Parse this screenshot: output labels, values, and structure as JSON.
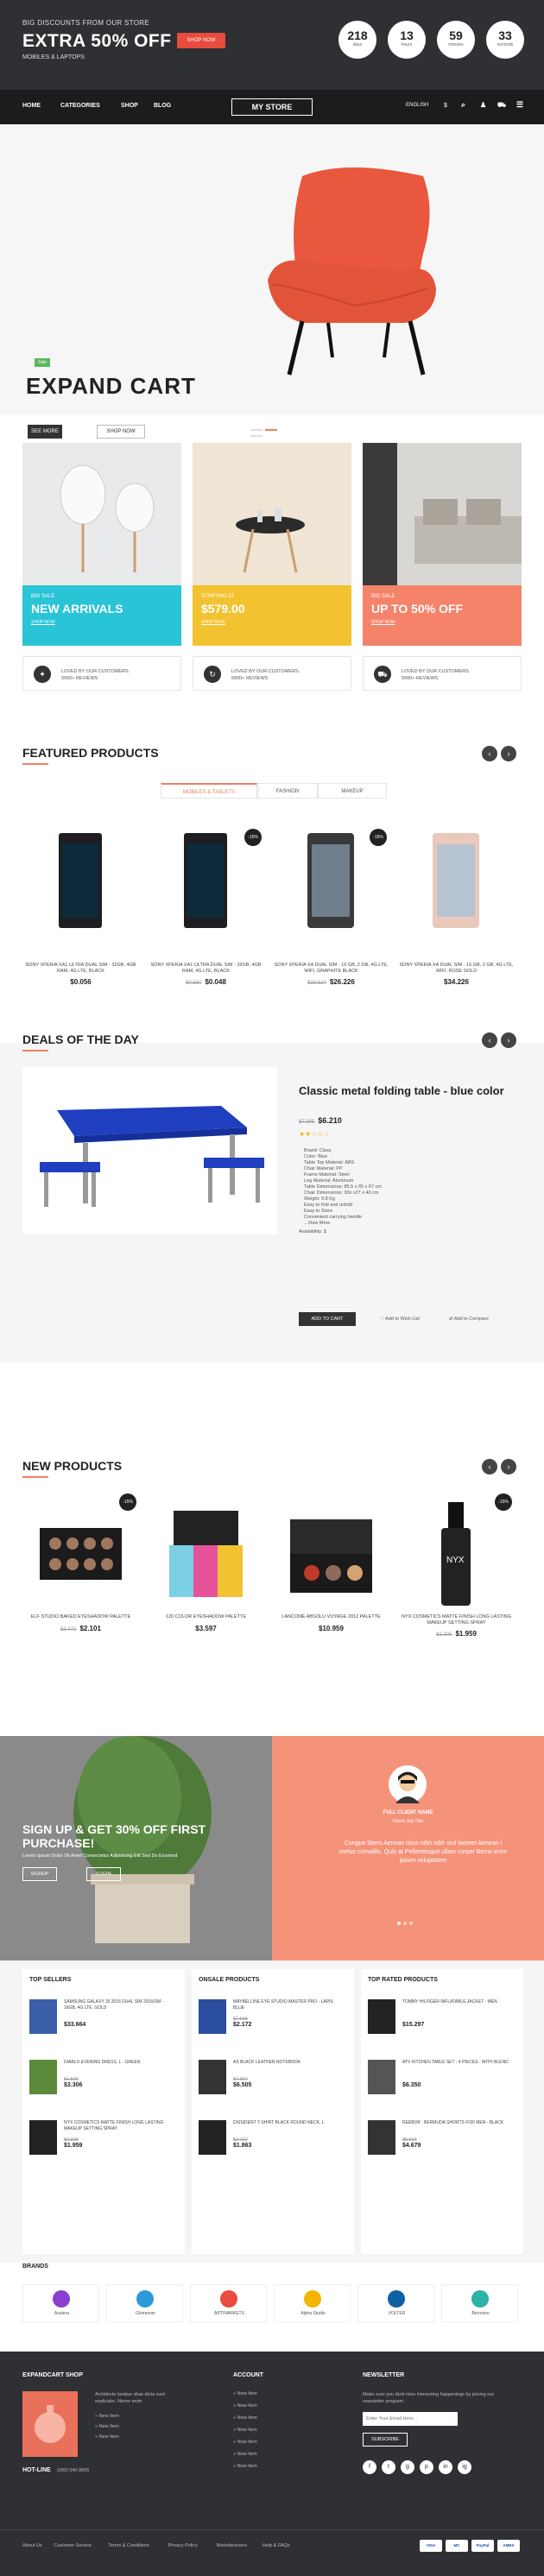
{
  "topbar": {
    "line1": "BIG DISCOUNTS FROM OUR STORE",
    "line2": "EXTRA 50% OFF",
    "line3": "MOBILES & LAPTOPS",
    "shop_btn": "SHOP NOW",
    "countdown": [
      {
        "value": "218",
        "label": "days"
      },
      {
        "value": "13",
        "label": "hours"
      },
      {
        "value": "59",
        "label": "minutes"
      },
      {
        "value": "33",
        "label": "seconds"
      }
    ]
  },
  "nav": {
    "items": [
      "HOME",
      "CATEGORIES",
      "SHOP",
      "BLOG"
    ],
    "logo": "MY STORE",
    "language": "ENGLISH",
    "currency": "$"
  },
  "hero": {
    "badge": "Sale",
    "title": "EXPAND CART",
    "see_more": "SEE MORE",
    "shop_now": "SHOP NOW"
  },
  "banners": [
    {
      "small": "BIG SALE",
      "big": "NEW ARRIVALS",
      "link": "SHOP NOW",
      "color": "#29c4d6"
    },
    {
      "small": "STARTING AT",
      "big": "$579.00",
      "link": "SHOP NOW",
      "color": "#f2c230"
    },
    {
      "small": "BIG SALE",
      "big": "UP TO 50% OFF",
      "link": "SHOP NOW",
      "color": "#f5836a"
    }
  ],
  "features": [
    {
      "icon": "tag-icon",
      "text1": "LOVED BY OUR CUSTOMERS.",
      "text2": "5000+ REVIEWS"
    },
    {
      "icon": "refresh-icon",
      "text1": "LOVED BY OUR CUSTOMERS.",
      "text2": "5000+ REVIEWS"
    },
    {
      "icon": "truck-icon",
      "text1": "LOVED BY OUR CUSTOMERS.",
      "text2": "5000+ REVIEWS"
    }
  ],
  "featured": {
    "title": "FEATURED PRODUCTS",
    "tabs": [
      "MOBILES & TABLETS",
      "FASHION",
      "MAKEUP"
    ],
    "products": [
      {
        "name": "SONY XPERIA XA1 ULTRA DUAL SIM - 32GB, 4GB RAM, 4G LTE, BLACK",
        "old": "",
        "price": "$0.056",
        "discount": ""
      },
      {
        "name": "SONY XPERIA XA1 ULTRA DUAL SIM - 32GB, 4GB RAM, 4G LTE, BLACK",
        "old": "$0.560",
        "price": "$0.048",
        "discount": "-15%"
      },
      {
        "name": "SONY XPERIA XA DUAL SIM - 16 GB, 2 GB, 4G LTE, WIFI, GRAPHITE BLACK",
        "old": "$30.824",
        "price": "$26.226",
        "discount": "-15%"
      },
      {
        "name": "SONY XPERIA XA DUAL SIM - 16 GB, 2 GB, 4G LTE, WIFI, ROSE GOLD",
        "old": "",
        "price": "$34.226",
        "discount": ""
      }
    ]
  },
  "deals": {
    "title": "DEALS OF THE DAY",
    "product_title": "Classic metal folding table - blue color",
    "old": "$7.305",
    "price": "$6.210",
    "specs": [
      "Brand: Class",
      "Color: Blue",
      "Table Top Material: ABS",
      "Chair Material: PP",
      "Frame Material: Steel",
      "Leg Material: Aluminum",
      "Table Dimensions: 85.5 x 65 x 67 cm",
      "Chair Dimensions: 30x x27 x 40 cm",
      "Weight: 9.8 Kg",
      "Easy to fold and unfold",
      "Easy to Store",
      "Convenient carrying handle",
      "...View More"
    ],
    "availability_label": "Availability:",
    "availability": "1",
    "add_to_cart": "ADD TO CART",
    "wishlist": "Add to Wish List",
    "compare": "Add to Compare"
  },
  "new_products": {
    "title": "NEW PRODUCTS",
    "products": [
      {
        "name": "ELF STUDIO BAKED EYESHADOW PALETTE",
        "old": "$2.472",
        "price": "$2.101",
        "discount": "-15%"
      },
      {
        "name": "120 COLOR EYESHADOW PALETTE",
        "old": "",
        "price": "$3.597",
        "discount": ""
      },
      {
        "name": "LANCOME ABSOLU VOYAGE 2012 PALETTE",
        "old": "",
        "price": "$10.959",
        "discount": ""
      },
      {
        "name": "NYX COSMETICS MATTE FINISH LONG LASTING MAKEUP SETTING SPRAY",
        "old": "$2.305",
        "price": "$1.959",
        "discount": "-15%"
      }
    ]
  },
  "promo": {
    "title": "SIGN UP & GET 30% OFF FIRST PURCHASE!",
    "text": "Lorem Ipsum Dolor Sit Amet Consectetur Adipisicing Elit Sed Do Eiusmod",
    "signup": "SIGNUP",
    "login": "LOGIN",
    "name": "FULL CLIENT NAME",
    "role": "Client Job Title",
    "quote": "Congue libero Aenean risus nibh nibh sed laoreet Aenean i metus convallis. Quis at Pellentesque ullam corper Bemo enim ipsum voluptatem"
  },
  "mini_lists": [
    {
      "title": "TOP SELLERS",
      "items": [
        {
          "name": "SAMSUNG GALAXY J5 2016 DUAL SIM 2016(SM - 16GB, 4G LTE, GOLD",
          "old": "",
          "price": "$33.664"
        },
        {
          "name": "DIABLO EVENING DRESS, L - GREEN",
          "old": "$1.500",
          "price": "$3.306"
        },
        {
          "name": "NYX COSMETICS MATTE FINISH LONG LASTING MAKEUP SETTING SPRAY",
          "old": "$2.305",
          "price": "$1.959"
        }
      ]
    },
    {
      "title": "ONSALE PRODUCTS",
      "items": [
        {
          "name": "MAYBELLINE EYE STUDIO MASTER PRO - LAPIS BLUE",
          "old": "$2.555",
          "price": "$2.172"
        },
        {
          "name": "AS BLACK LEATHER NOTEBOOK",
          "old": "$7.657",
          "price": "$6.505"
        },
        {
          "name": "DISSIDENT T-SHIRT BLACK ROUND NECK, L",
          "old": "$2.192",
          "price": "$1.863"
        }
      ]
    },
    {
      "title": "TOP RATED PRODUCTS",
      "items": [
        {
          "name": "TOMMY HILFIGER INFLATABLE JACKET - MEN",
          "old": "",
          "price": "$15.297"
        },
        {
          "name": "ATV KITCHEN TABLE SET - 4 PIECES - WITH BLEND",
          "old": "",
          "price": "$6.350"
        },
        {
          "name": "REEBOK : BERMUDA SHORTS FOR MEN - BLACK",
          "old": "$5.501",
          "price": "$4.679"
        }
      ]
    }
  ],
  "brands": {
    "title": "BRANDS",
    "items": [
      {
        "name": "Avatera",
        "color": "#8a3fd1"
      },
      {
        "name": "Glomeean",
        "color": "#2a9ad8"
      },
      {
        "name": "ARTINARKETS",
        "color": "#e94b3c"
      },
      {
        "name": "Alpha Studio",
        "color": "#f4b400"
      },
      {
        "name": "VOLTER",
        "color": "#0b61a4"
      },
      {
        "name": "Bernomo",
        "color": "#2ab3a6"
      }
    ]
  },
  "footer": {
    "shop_title": "EXPANDCART SHOP",
    "about": "Architecto beatae vitae dicta sunt explicabo. Nemo enim",
    "links": [
      "New Item",
      "New Item",
      "New Item"
    ],
    "hotline_label": "HOT-LINE",
    "hotline": "(090) 040 8665",
    "account_title": "ACCOUNT",
    "account_links": [
      "New Item",
      "New Item",
      "New Item",
      "New Item",
      "New Item",
      "New Item",
      "New Item"
    ],
    "newsletter_title": "NEWSLETTER",
    "newsletter_text": "Make sure you dont miss interesting happenings by joining our newsletter program.",
    "email_placeholder": "Enter Your Email Here...",
    "subscribe": "SUBSCRIBE",
    "social": [
      "f",
      "t",
      "g",
      "p",
      "in",
      "ig"
    ],
    "bottom_links": [
      "About Us",
      "Customer Service",
      "Terms & Conditions",
      "Privacy Policy",
      "Manufacturers",
      "Help & FAQs"
    ],
    "payments": [
      "VISA",
      "MC",
      "PayPal",
      "AMEX"
    ]
  }
}
